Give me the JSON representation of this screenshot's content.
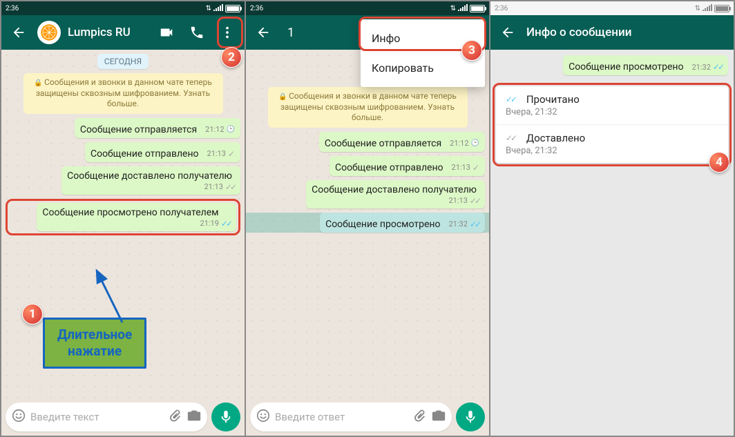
{
  "status_time": "2:36",
  "panel1": {
    "contact_name": "Lumpics RU",
    "date_chip": "СЕГОДНЯ",
    "encryption_banner": "Сообщения и звонки в данном чате теперь защищены сквозным шифрованием. Узнать больше.",
    "messages": [
      {
        "text": "Сообщение отправляется",
        "time": "21:12",
        "status": "clock"
      },
      {
        "text": "Сообщение отправлено",
        "time": "21:13",
        "status": "sent"
      },
      {
        "text": "Сообщение доставлено получателю",
        "time": "21:13",
        "status": "delivered"
      },
      {
        "text": "Сообщение просмотрено получателем",
        "time": "21:19",
        "status": "read"
      }
    ],
    "input_placeholder": "Введите текст",
    "callout": "Длительное\nнажатие",
    "badge1": "1",
    "badge2": "2"
  },
  "panel2": {
    "selection_count": "1",
    "menu_info": "Инфо",
    "menu_copy": "Копировать",
    "encryption_banner": "Сообщения и звонки в данном чате теперь защищены сквозным шифрованием. Узнать больше.",
    "messages": [
      {
        "text": "Сообщение отправляется",
        "time": "21:12",
        "status": "clock"
      },
      {
        "text": "Сообщение отправлено",
        "time": "21:13",
        "status": "sent"
      },
      {
        "text": "Сообщение доставлено получателю",
        "time": "21:13",
        "status": "delivered"
      },
      {
        "text": "Сообщение просмотрено",
        "time": "21:32",
        "status": "read"
      }
    ],
    "input_placeholder": "Введите ответ",
    "badge3": "3"
  },
  "panel3": {
    "title": "Инфо о сообщении",
    "message": {
      "text": "Сообщение просмотрено",
      "time": "21:32",
      "status": "read"
    },
    "read_label": "Прочитано",
    "read_time": "Вчера, 21:32",
    "delivered_label": "Доставлено",
    "delivered_time": "Вчера, 21:32",
    "badge4": "4"
  }
}
